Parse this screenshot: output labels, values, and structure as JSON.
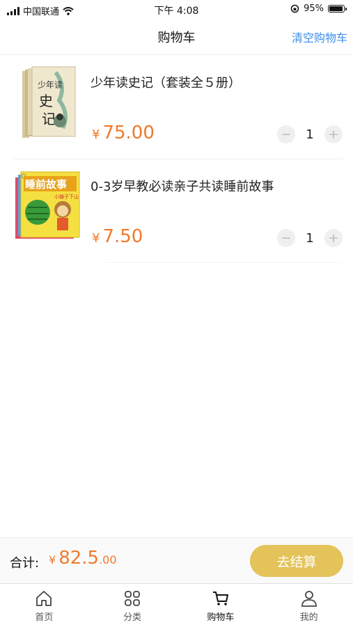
{
  "status_bar": {
    "carrier": "中国联通",
    "time": "下午 4:08",
    "battery": "95%"
  },
  "header": {
    "title": "购物车",
    "clear_label": "清空购物车"
  },
  "cart": {
    "items": [
      {
        "title": "少年读史记（套装全５册）",
        "currency": "¥",
        "price": "75.00",
        "quantity": "1",
        "cover_text": "少年读史记"
      },
      {
        "title": "0-3岁早教必读亲子共读睡前故事",
        "currency": "¥",
        "price": "7.50",
        "quantity": "1",
        "cover_text": "睡前故事",
        "cover_subtext": "小猴子下山"
      }
    ]
  },
  "summary": {
    "total_label": "合计:",
    "currency": "¥",
    "total_main": "82.5",
    "total_decimal": ".00",
    "checkout_label": "去结算"
  },
  "tabbar": {
    "tabs": [
      {
        "label": "首页",
        "icon": "home-icon"
      },
      {
        "label": "分类",
        "icon": "grid-icon"
      },
      {
        "label": "购物车",
        "icon": "cart-icon"
      },
      {
        "label": "我的",
        "icon": "user-icon"
      }
    ]
  },
  "colors": {
    "accent": "#3b8ee8",
    "price": "#f07a2a",
    "checkout": "#e3c35a"
  }
}
